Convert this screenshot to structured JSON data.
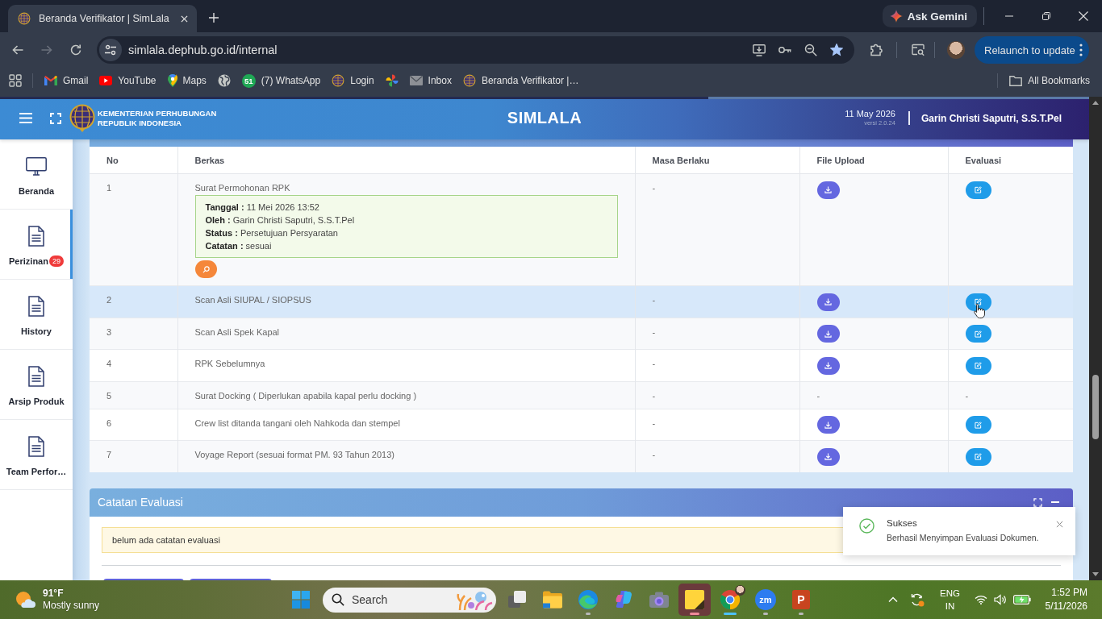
{
  "browser": {
    "tab": {
      "title": "Beranda Verifikator | SimLala"
    },
    "gemini_button": "Ask Gemini",
    "forward_disabled": true,
    "url": "simlala.dephub.go.id/internal",
    "bookmarked": true,
    "relaunch_button": "Relaunch to update",
    "bookmarks": [
      {
        "kind": "gmail",
        "label": "Gmail"
      },
      {
        "kind": "youtube",
        "label": "YouTube"
      },
      {
        "kind": "maps",
        "label": "Maps"
      },
      {
        "kind": "globe"
      },
      {
        "kind": "whatsapp",
        "badge": "51",
        "label": "(7) WhatsApp"
      },
      {
        "kind": "emblem",
        "label": "Login"
      },
      {
        "kind": "pinwheel"
      },
      {
        "kind": "mail",
        "label": "Inbox"
      },
      {
        "kind": "emblem",
        "label": "Beranda Verifikator |…"
      }
    ],
    "all_bookmarks": "All Bookmarks"
  },
  "loading_bar": {
    "level": 0.65
  },
  "app_header": {
    "org_name": [
      "KEMENTERIAN PERHUBUNGAN",
      "REPUBLIK INDONESIA"
    ],
    "title": "SIMLALA",
    "date": "11 May 2026",
    "version": "versi 2.0.24",
    "user": "Garin Christi Saputri, S.S.T.Pel"
  },
  "sidebar": {
    "items": [
      {
        "kind": "monitor",
        "label": "Beranda",
        "selected": false
      },
      {
        "kind": "document",
        "label": "Perizinan",
        "badge": "29",
        "selected": true
      },
      {
        "kind": "document",
        "label": "History",
        "selected": false
      },
      {
        "kind": "document",
        "label": "Arsip Produk",
        "selected": false
      },
      {
        "kind": "document",
        "label": "Team Perfor…",
        "selected": false
      }
    ]
  },
  "documents_table": {
    "columns": [
      "No",
      "Berkas",
      "Masa Berlaku",
      "File Upload",
      "Evaluasi"
    ],
    "rows": [
      {
        "no": "1",
        "berkas": "Surat Permohonan RPK",
        "detail": [
          "**Tanggal :** 11 Mei 2026 13:52",
          "**Oleh :** Garin Christi Saputri, S.S.T.Pel",
          "**Status :** Persetujuan Persyaratan",
          "**Catatan :** sesuai"
        ],
        "masa_berlaku": "-",
        "file_upload": {
          "kind": "download"
        },
        "evaluasi": {
          "kind": "edit"
        },
        "hovered": false
      },
      {
        "no": "2",
        "berkas": "Scan Asli SIUPAL / SIOPSUS",
        "masa_berlaku": "-",
        "file_upload": {
          "kind": "download"
        },
        "evaluasi": {
          "kind": "edit"
        },
        "hovered": true
      },
      {
        "no": "3",
        "berkas": "Scan Asli Spek Kapal",
        "masa_berlaku": "-",
        "file_upload": {
          "kind": "download"
        },
        "evaluasi": {
          "kind": "edit"
        },
        "hovered": false
      },
      {
        "no": "4",
        "berkas": "RPK Sebelumnya",
        "masa_berlaku": "-",
        "file_upload": {
          "kind": "download"
        },
        "evaluasi": {
          "kind": "edit"
        },
        "hovered": false
      },
      {
        "no": "5",
        "berkas": "Surat Docking ( Diperlukan apabila kapal perlu docking )",
        "masa_berlaku": "-",
        "file_upload": {
          "kind": "text",
          "text": "-"
        },
        "evaluasi": {
          "kind": "text",
          "text": "-"
        },
        "hovered": false
      },
      {
        "no": "6",
        "berkas": "Crew list ditanda tangani oleh Nahkoda dan stempel",
        "masa_berlaku": "-",
        "file_upload": {
          "kind": "download"
        },
        "evaluasi": {
          "kind": "edit"
        },
        "hovered": false
      },
      {
        "no": "7",
        "berkas": "Voyage Report (sesuai format PM. 93 Tahun 2013)",
        "masa_berlaku": "-",
        "file_upload": {
          "kind": "download"
        },
        "evaluasi": {
          "kind": "edit"
        },
        "hovered": false
      }
    ]
  },
  "evaluation_notes": {
    "title": "Catatan Evaluasi",
    "message": "belum ada catatan evaluasi"
  },
  "toast": {
    "kind": "success",
    "title": "Sukses",
    "message": "Berhasil Menyimpan Evaluasi Dokumen."
  },
  "taskbar": {
    "weather": {
      "temperature": "91°F",
      "condition": "Mostly sunny"
    },
    "search_placeholder": "Search",
    "apps": [
      {
        "kind": "taskview",
        "running": false,
        "focused": false,
        "attention": false
      },
      {
        "kind": "explorer",
        "running": false,
        "focused": false,
        "attention": false
      },
      {
        "kind": "edge",
        "running": true,
        "focused": false,
        "attention": false
      },
      {
        "kind": "copilot",
        "running": false,
        "focused": false,
        "attention": false
      },
      {
        "kind": "camera",
        "running": false,
        "focused": false,
        "attention": false
      },
      {
        "kind": "sticky",
        "running": true,
        "focused": false,
        "attention": true
      },
      {
        "kind": "chrome",
        "running": true,
        "focused": true,
        "attention": false
      },
      {
        "kind": "zoom",
        "glyph": "zm",
        "running": true,
        "focused": false,
        "attention": false
      },
      {
        "kind": "powerpoint",
        "glyph": "P",
        "running": true,
        "focused": false,
        "attention": false
      }
    ],
    "language": [
      "ENG",
      "IN"
    ],
    "time": "1:52 PM",
    "date": "5/11/2026"
  }
}
